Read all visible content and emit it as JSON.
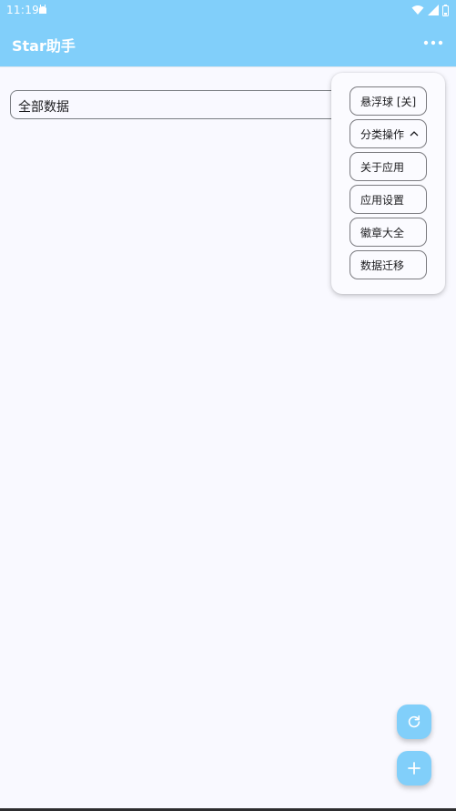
{
  "status_bar": {
    "time": "11:19"
  },
  "app_bar": {
    "title": "Star助手"
  },
  "category_field": {
    "value": "全部数据"
  },
  "popup_menu": {
    "items": [
      {
        "label": "悬浮球 [关]"
      },
      {
        "label": "分类操作"
      },
      {
        "label": "关于应用"
      },
      {
        "label": "应用设置"
      },
      {
        "label": "徽章大全"
      },
      {
        "label": "数据迁移"
      }
    ]
  },
  "icons": {
    "overflow": "more-horiz-icon",
    "refresh": "refresh-icon",
    "add": "add-icon",
    "chevron": "chevron-up-icon"
  },
  "colors": {
    "primary": "#81cffa",
    "background": "#f9f9ff"
  }
}
